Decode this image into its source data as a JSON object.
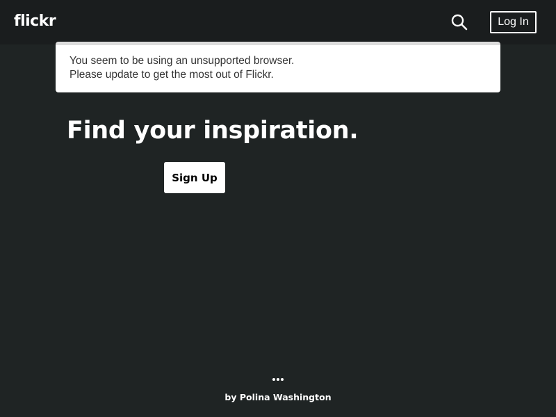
{
  "header": {
    "logo_text": "flickr",
    "search_icon": "search-icon",
    "login_label": "Log In"
  },
  "notice": {
    "line1": "You seem to be using an unsupported browser.",
    "line2": "Please update to get the most out of Flickr."
  },
  "hero": {
    "title": "Find your inspiration.",
    "signup_label": "Sign Up"
  },
  "footer": {
    "more_icon": "more-dots-icon",
    "credit_prefix": "by",
    "credit_author": "Polina Washington"
  },
  "colors": {
    "background": "#1f2424",
    "header_background": "#1a1d1e",
    "notice_background": "#ffffff",
    "text_primary": "#ffffff"
  }
}
